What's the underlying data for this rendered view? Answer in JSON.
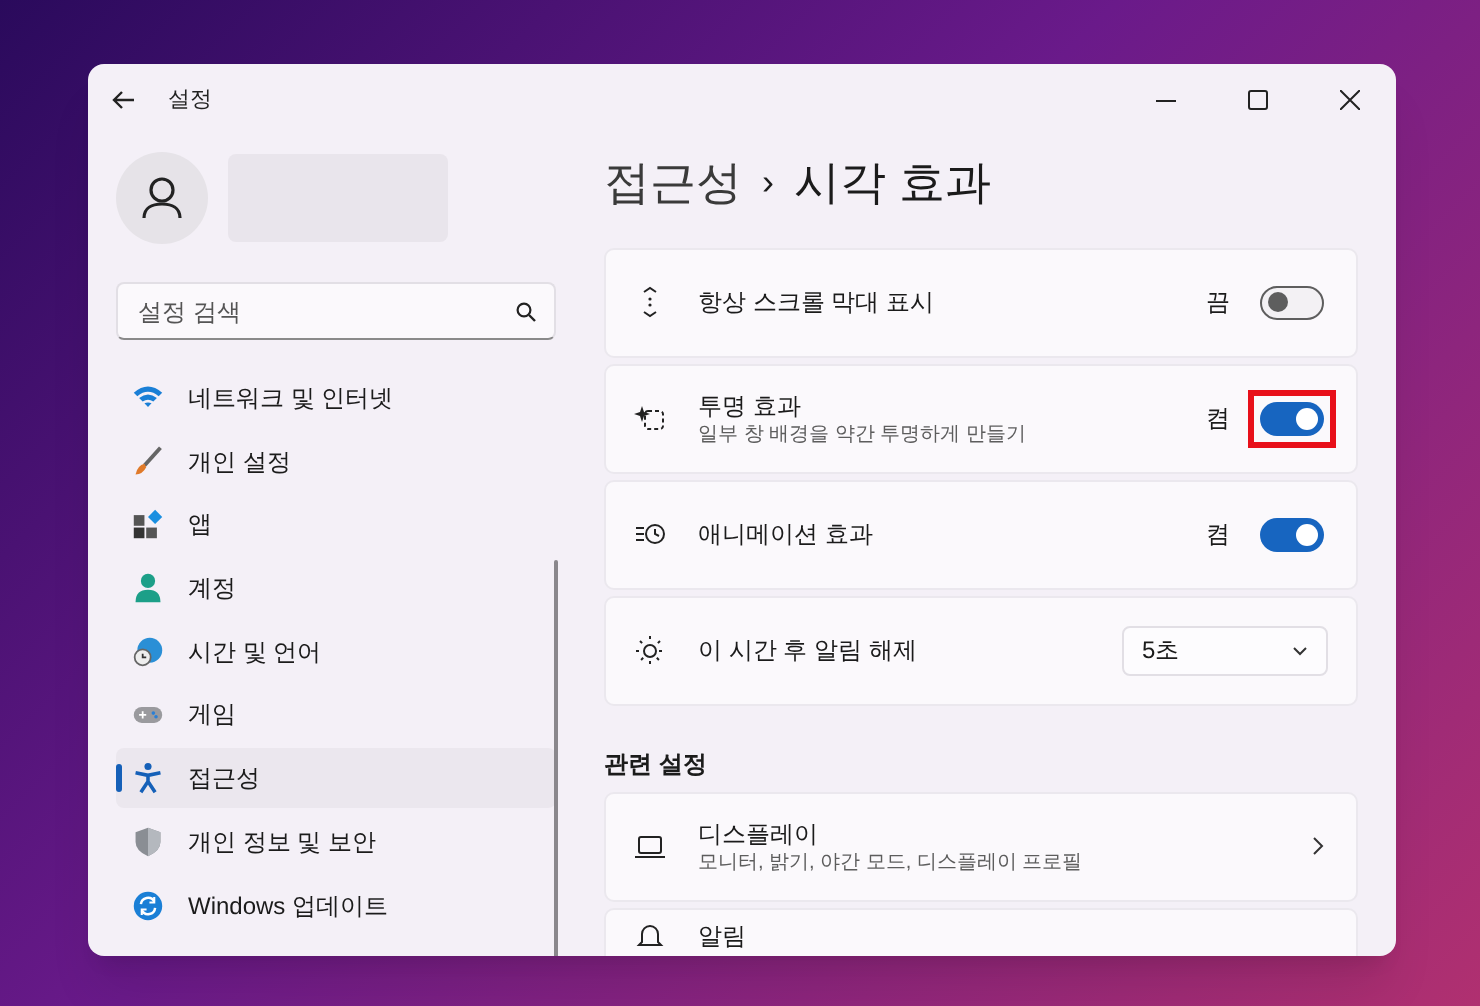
{
  "window": {
    "title": "설정"
  },
  "search": {
    "placeholder": "설정 검색"
  },
  "sidebar": {
    "items": [
      {
        "label": "네트워크 및 인터넷",
        "selected": false
      },
      {
        "label": "개인 설정",
        "selected": false
      },
      {
        "label": "앱",
        "selected": false
      },
      {
        "label": "계정",
        "selected": false
      },
      {
        "label": "시간 및 언어",
        "selected": false
      },
      {
        "label": "게임",
        "selected": false
      },
      {
        "label": "접근성",
        "selected": true
      },
      {
        "label": "개인 정보 및 보안",
        "selected": false
      },
      {
        "label": "Windows 업데이트",
        "selected": false
      }
    ]
  },
  "breadcrumb": {
    "parent": "접근성",
    "separator": "›",
    "current": "시각 효과"
  },
  "settings": [
    {
      "kind": "toggle",
      "title": "항상 스크롤 막대 표시",
      "state_label": "끔",
      "on": false,
      "highlighted": false
    },
    {
      "kind": "toggle",
      "title": "투명 효과",
      "description": "일부 창 배경을 약간 투명하게 만들기",
      "state_label": "켬",
      "on": true,
      "highlighted": true
    },
    {
      "kind": "toggle",
      "title": "애니메이션 효과",
      "state_label": "켬",
      "on": true,
      "highlighted": false
    },
    {
      "kind": "dropdown",
      "title": "이 시간 후 알림 해제",
      "value": "5초"
    }
  ],
  "related": {
    "heading": "관련 설정",
    "items": [
      {
        "title": "디스플레이",
        "description": "모니터, 밝기, 야간 모드, 디스플레이 프로필"
      },
      {
        "title": "알림"
      }
    ]
  }
}
